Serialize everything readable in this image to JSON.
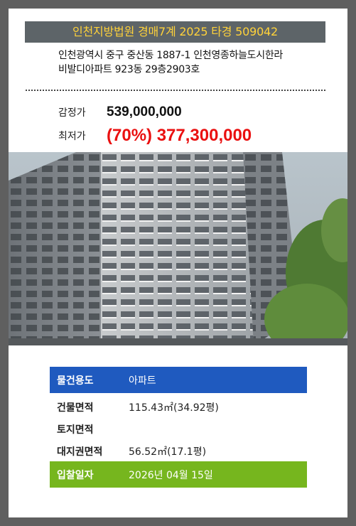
{
  "header": {
    "court_case": "인천지방법원 경매7계 2025 타경 509042"
  },
  "address": {
    "line1": "인천광역시 중구 중산동 1887-1 인천영종하늘도시한라",
    "line2": "비발디아파트 923동 29층2903호"
  },
  "prices": {
    "appraisal_label": "감정가",
    "appraisal_value": "539,000,000",
    "minimum_label": "최저가",
    "minimum_value": "(70%) 377,300,000"
  },
  "photo": {
    "subject": "apartment-building-photo"
  },
  "details": {
    "property_type_label": "물건용도",
    "property_type_value": "아파트",
    "building_area_label": "건물면적",
    "building_area_value": "115.43㎡(34.92평)",
    "land_area_label": "토지면적",
    "land_area_value": "",
    "land_right_area_label": "대지권면적",
    "land_right_area_value": "56.52㎡(17.1평)",
    "bid_date_label": "입찰일자",
    "bid_date_value": "2026년 04월 15일"
  },
  "colors": {
    "background": "#5f5f5f",
    "court_bar": "#5d6468",
    "court_text": "#ffd23a",
    "minimum_price": "#ea1010",
    "type_row": "#1f5abf",
    "bid_row": "#76b61e"
  }
}
